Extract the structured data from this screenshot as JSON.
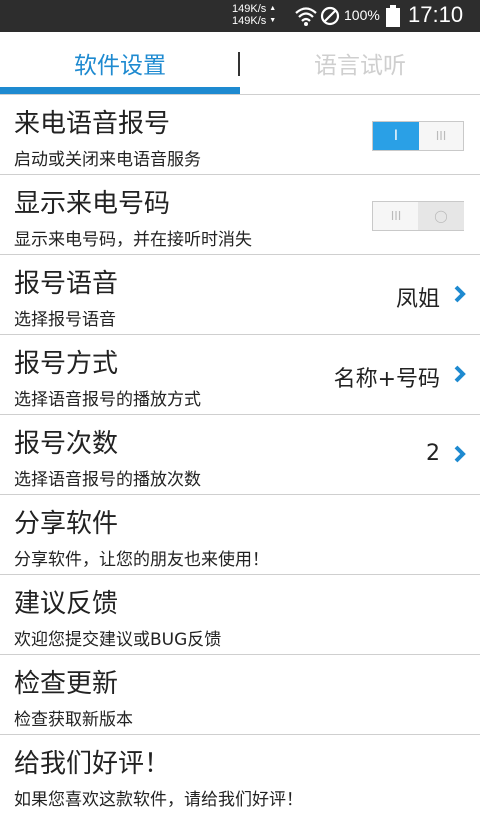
{
  "status_bar": {
    "speed_up": "149K/s",
    "speed_down": "149K/s",
    "battery_percent": "100%",
    "time": "17:10",
    "icons": [
      "wifi-icon",
      "no-sim-icon",
      "battery-icon"
    ]
  },
  "tabs": [
    {
      "label": "软件设置",
      "active": true
    },
    {
      "label": "语言试听",
      "active": false
    }
  ],
  "settings": [
    {
      "title": "来电语音报号",
      "subtitle": "启动或关闭来电语音服务",
      "control": "toggle",
      "on": true,
      "on_mark": "I",
      "off_mark": "III"
    },
    {
      "title": "显示来电号码",
      "subtitle": "显示来电号码，并在接听时消失",
      "control": "toggle",
      "on": false,
      "off_mark": "III",
      "knob_mark": "◯"
    },
    {
      "title": "报号语音",
      "subtitle": "选择报号语音",
      "value": "凤姐",
      "control": "chevron"
    },
    {
      "title": "报号方式",
      "subtitle": "选择语音报号的播放方式",
      "value": "名称+号码",
      "control": "chevron"
    },
    {
      "title": "报号次数",
      "subtitle": "选择语音报号的播放次数",
      "value": "2",
      "control": "chevron"
    },
    {
      "title": "分享软件",
      "subtitle": "分享软件，让您的朋友也来使用！"
    },
    {
      "title": "建议反馈",
      "subtitle": "欢迎您提交建议或BUG反馈"
    },
    {
      "title": "检查更新",
      "subtitle": "检查获取新版本"
    },
    {
      "title": "给我们好评！",
      "subtitle": "如果您喜欢这款软件，请给我们好评！"
    }
  ],
  "colors": {
    "accent": "#1e8ad0",
    "toggle_on": "#2aa0e6",
    "status_bar_bg": "#2d2d2d",
    "divider": "#cfcfcf"
  }
}
